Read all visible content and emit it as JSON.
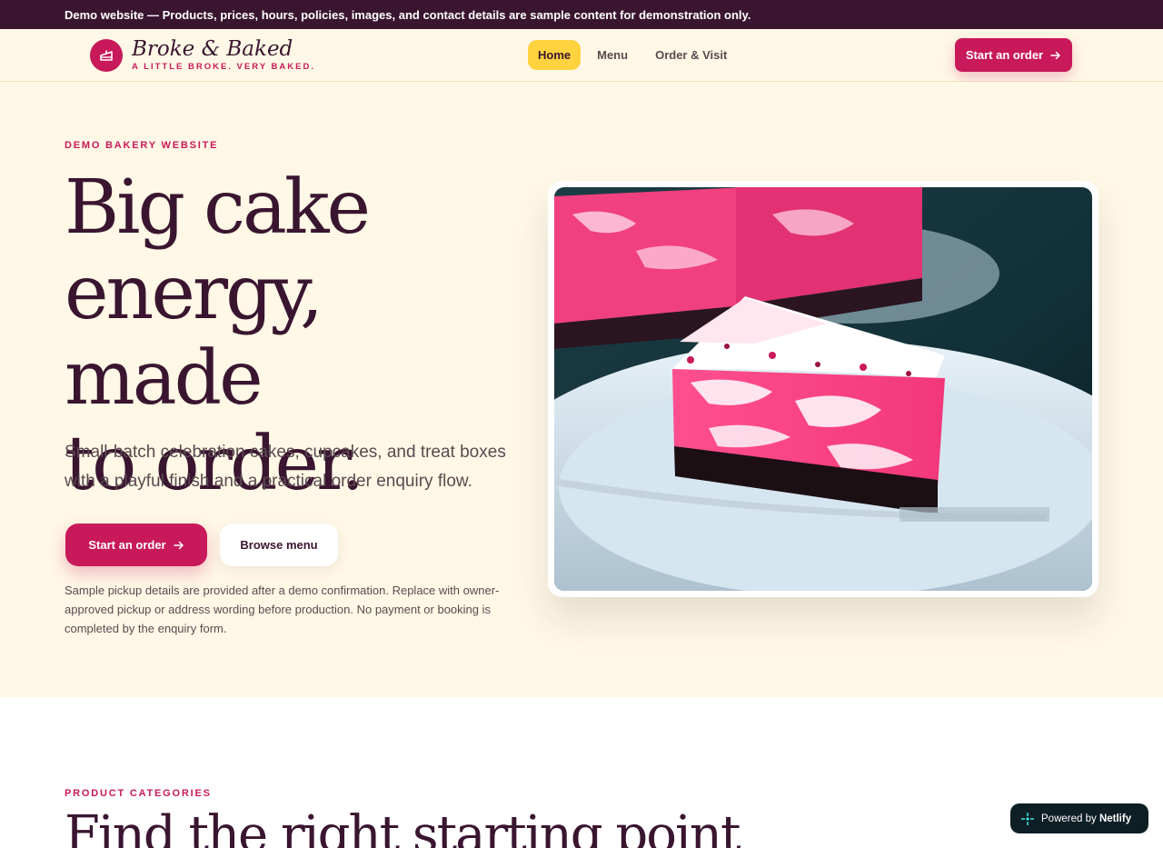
{
  "banner": {
    "text": "Demo website — Products, prices, hours, policies, images, and contact details are sample content for demonstration only."
  },
  "header": {
    "brand_name": "Broke & Baked",
    "brand_tagline": "A LITTLE BROKE. VERY BAKED.",
    "logo_icon": "cake-slice-icon",
    "nav": [
      {
        "label": "Home",
        "active": true
      },
      {
        "label": "Menu",
        "active": false
      },
      {
        "label": "Order & Visit",
        "active": false
      }
    ],
    "cta_label": "Start an order",
    "cta_icon": "arrow-right-icon"
  },
  "hero": {
    "eyebrow": "DEMO BAKERY WEBSITE",
    "title_lines": [
      "Big cake",
      "energy, made",
      "to order."
    ],
    "lead": "Small-batch celebration cakes, cupcakes, and treat boxes with a playful finish and a practical order enquiry flow.",
    "primary_button": "Start an order",
    "secondary_button": "Browse menu",
    "note": "Sample pickup details are provided after a demo confirmation. Replace with owner-approved pickup or address wording before production. No payment or booking is completed by the enquiry form.",
    "image_alt": "Slice of pink marbled cheesecake on a plate"
  },
  "categories": {
    "eyebrow": "PRODUCT CATEGORIES",
    "title": "Find the right starting point"
  },
  "badge": {
    "prefix": "Powered by",
    "brand": "Netlify"
  },
  "colors": {
    "brand_pink": "#c8195a",
    "plum": "#3a1530",
    "cream": "#fff8e6",
    "nav_active": "#ffd23f"
  }
}
